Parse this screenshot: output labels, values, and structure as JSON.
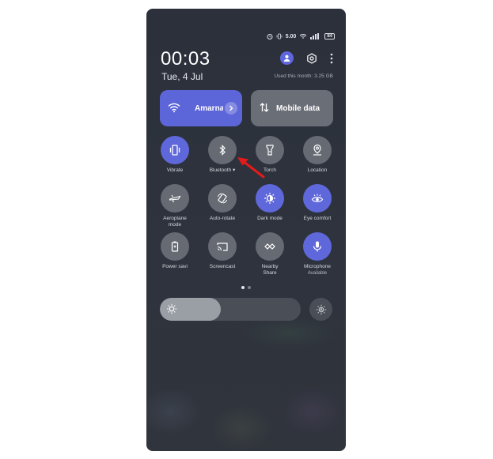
{
  "status": {
    "data_speed": "5.00",
    "battery": "84"
  },
  "header": {
    "time": "00:03",
    "date": "Tue, 4 Jul",
    "usage": "Used this month: 3.25 GB"
  },
  "big_tiles": {
    "wifi": "Amarna",
    "mobile_data": "Mobile data"
  },
  "toggles": [
    {
      "label": "Vibrate",
      "active": true,
      "icon": "vibrate-icon"
    },
    {
      "label": "Bluetooth ▾",
      "active": false,
      "icon": "bluetooth-icon"
    },
    {
      "label": "Torch",
      "active": false,
      "icon": "torch-icon"
    },
    {
      "label": "Location",
      "active": false,
      "icon": "location-icon"
    },
    {
      "label": "Aeroplane mode",
      "active": false,
      "icon": "aeroplane-icon"
    },
    {
      "label": "Auto-rotate",
      "active": false,
      "icon": "rotate-icon"
    },
    {
      "label": "Dark mode",
      "active": true,
      "icon": "dark-mode-icon"
    },
    {
      "label": "Eye comfort",
      "active": true,
      "icon": "eye-icon"
    },
    {
      "label": "Power savi",
      "active": false,
      "icon": "battery-icon"
    },
    {
      "label": "Screencast",
      "active": false,
      "icon": "screencast-icon"
    },
    {
      "label": "Nearby Share",
      "active": false,
      "icon": "nearby-share-icon"
    },
    {
      "label": "Microphone",
      "sublabel": "Available",
      "active": true,
      "icon": "microphone-icon"
    }
  ],
  "pager": {
    "pages": 2,
    "current": 1
  },
  "brightness": {
    "level": 0.43
  },
  "colors": {
    "accent": "#5f68da",
    "tile_off": "#666a73",
    "panel": "#2e333d"
  }
}
